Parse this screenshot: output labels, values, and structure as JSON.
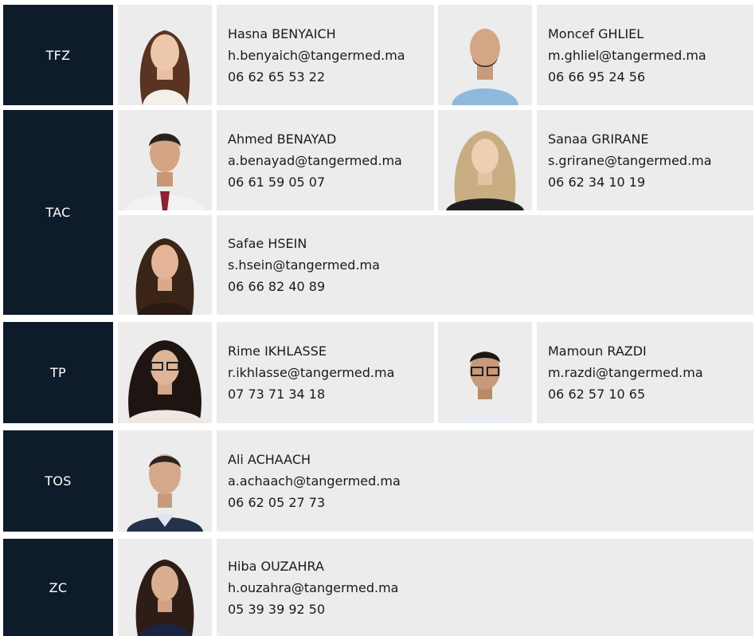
{
  "departments": {
    "tfz": "TFZ",
    "tac": "TAC",
    "tp": "TP",
    "tos": "TOS",
    "zc": "ZC"
  },
  "contacts": [
    {
      "name": "Hasna BENYAICH",
      "email": "h.benyaich@tangermed.ma",
      "phone": "06 62 65 53 22"
    },
    {
      "name": "Moncef GHLIEL",
      "email": "m.ghliel@tangermed.ma",
      "phone": "06 66 95 24 56"
    },
    {
      "name": "Ahmed BENAYAD",
      "email": "a.benayad@tangermed.ma",
      "phone": "06 61 59 05 07"
    },
    {
      "name": "Sanaa GRIRANE",
      "email": "s.grirane@tangermed.ma",
      "phone": "06 62 34 10 19"
    },
    {
      "name": "Safae HSEIN",
      "email": "s.hsein@tangermed.ma",
      "phone": "06 66 82 40 89"
    },
    {
      "name": "Rime IKHLASSE",
      "email": "r.ikhlasse@tangermed.ma",
      "phone": "07 73 71 34 18"
    },
    {
      "name": "Mamoun RAZDI",
      "email": "m.razdi@tangermed.ma",
      "phone": "06 62 57 10 65"
    },
    {
      "name": "Ali ACHAACH",
      "email": "a.achaach@tangermed.ma",
      "phone": "06 62 05 27 73"
    },
    {
      "name": "Hiba OUZAHRA",
      "email": "h.ouzahra@tangermed.ma",
      "phone": "05 39 39 92 50"
    }
  ],
  "colors": {
    "department_bg": "#0d1b2a",
    "cell_bg": "#ececec",
    "text": "#1a1a1a"
  }
}
